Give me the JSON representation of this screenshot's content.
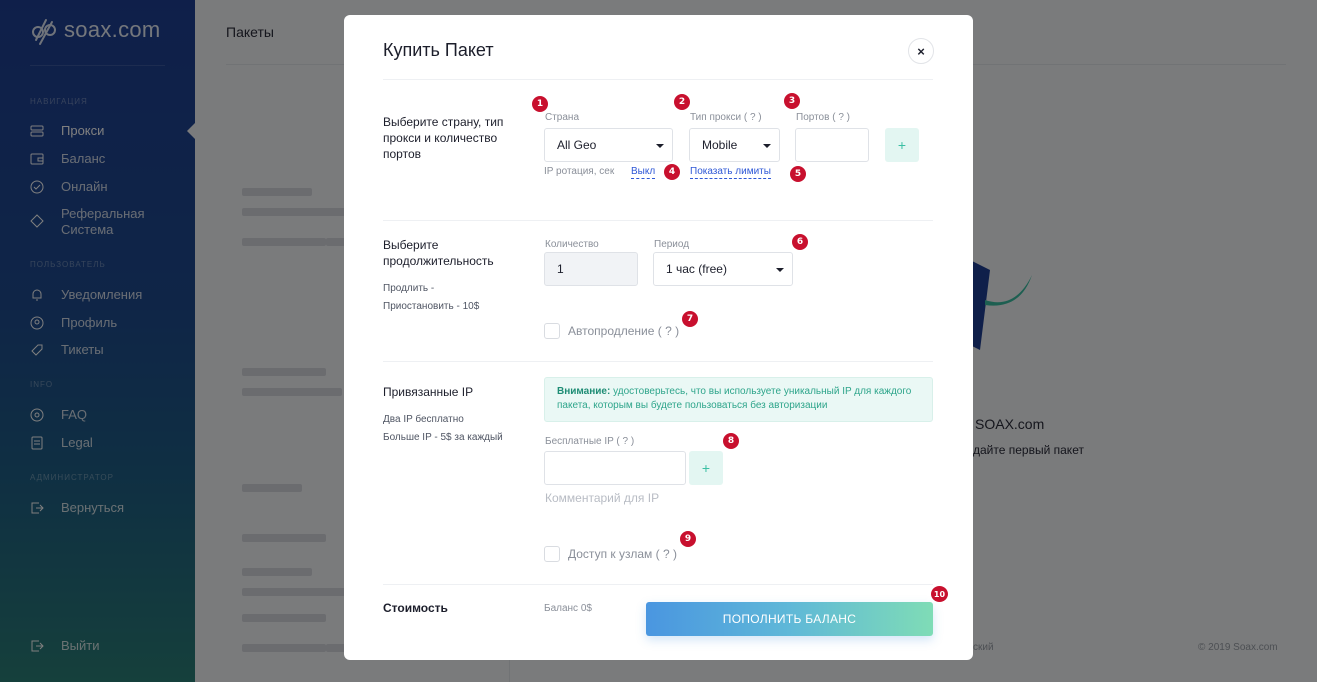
{
  "sidebar": {
    "logo": "soax.com",
    "sections": {
      "navigation": "НАВИГАЦИЯ",
      "user": "ПОЛЬЗОВАТЕЛЬ",
      "info": "INFO",
      "admin": "АДМИНИСТРАТОР"
    },
    "items": {
      "proxy": "Прокси",
      "balance": "Баланс",
      "online": "Онлайн",
      "referral": "Реферальная Система",
      "notifications": "Уведомления",
      "profile": "Профиль",
      "tickets": "Тикеты",
      "faq": "FAQ",
      "legal": "Legal",
      "back": "Вернуться",
      "logout": "Выйти"
    }
  },
  "page": {
    "title": "Пакеты",
    "welcome": "SOAX.com",
    "cta": "дайте первый пакет",
    "lang": "ский",
    "copyright": "© 2019 Soax.com"
  },
  "modal": {
    "title": "Купить Пакет",
    "close": "×",
    "section1": {
      "label": "Выберите страну, тип прокси и количество портов",
      "country_label": "Страна",
      "country_value": "All Geo",
      "proxy_type_label": "Тип прокси ( ? )",
      "proxy_type_value": "Mobile",
      "ports_label": "Портов ( ? )",
      "ports_value": "",
      "add": "+",
      "ip_rotation_label": "IP ротация, сек",
      "ip_rotation_value": "Выкл",
      "show_limits": "Показать лимиты"
    },
    "section2": {
      "label": "Выберите продолжительность",
      "sub1": "Продлить -",
      "sub2": "Приостановить - 10$",
      "quantity_label": "Количество",
      "quantity_value": "1",
      "period_label": "Период",
      "period_value": "1 час (free)",
      "autorenew": "Автопродление ( ? )"
    },
    "section3": {
      "label": "Привязанные IP",
      "sub1": "Два IP бесплатно",
      "sub2": "Больше IP - 5$ за каждый",
      "alert_bold": "Внимание:",
      "alert_text": " удостоверьтесь, что вы используете уникальный IP для каждого пакета, которым вы будете пользоваться без авторизации",
      "free_ip_label": "Бесплатные IP ( ? )",
      "free_ip_value": "",
      "add": "+",
      "comment_placeholder": "Комментарий для IP",
      "node_access": "Доступ к узлам ( ? )"
    },
    "cost": {
      "label": "Стоимость",
      "balance": "Баланс 0$",
      "topup_button": "ПОПОЛНИТЬ БАЛАНС"
    },
    "badges": [
      "1",
      "2",
      "3",
      "4",
      "5",
      "6",
      "7",
      "8",
      "9",
      "10"
    ]
  },
  "colors": {
    "accent_teal": "#3bbfa3",
    "link_blue": "#2e57d6",
    "badge_red": "#c8102e"
  }
}
